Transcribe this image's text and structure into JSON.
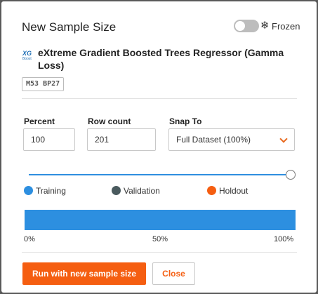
{
  "dialog": {
    "title": "New Sample Size",
    "frozen_label": "Frozen",
    "frozen_on": false
  },
  "model": {
    "logo_text": "XG",
    "logo_subtext": "Boost",
    "name": "eXtreme Gradient Boosted Trees Regressor (Gamma Loss)",
    "badge": "M53  BP27"
  },
  "fields": {
    "percent_label": "Percent",
    "percent_value": "100",
    "rowcount_label": "Row count",
    "rowcount_value": "201",
    "snap_label": "Snap To",
    "snap_value": "Full Dataset (100%)"
  },
  "slider": {
    "value_percent": 100
  },
  "legend": [
    {
      "label": "Training",
      "color": "#2d8fe0"
    },
    {
      "label": "Validation",
      "color": "#4a5a5e"
    },
    {
      "label": "Holdout",
      "color": "#f55e11"
    }
  ],
  "partition_bar": {
    "training_percent": 100,
    "validation_percent": 0,
    "holdout_percent": 0,
    "ticks": [
      "0%",
      "50%",
      "100%"
    ]
  },
  "buttons": {
    "run_label": "Run with new sample size",
    "close_label": "Close"
  }
}
